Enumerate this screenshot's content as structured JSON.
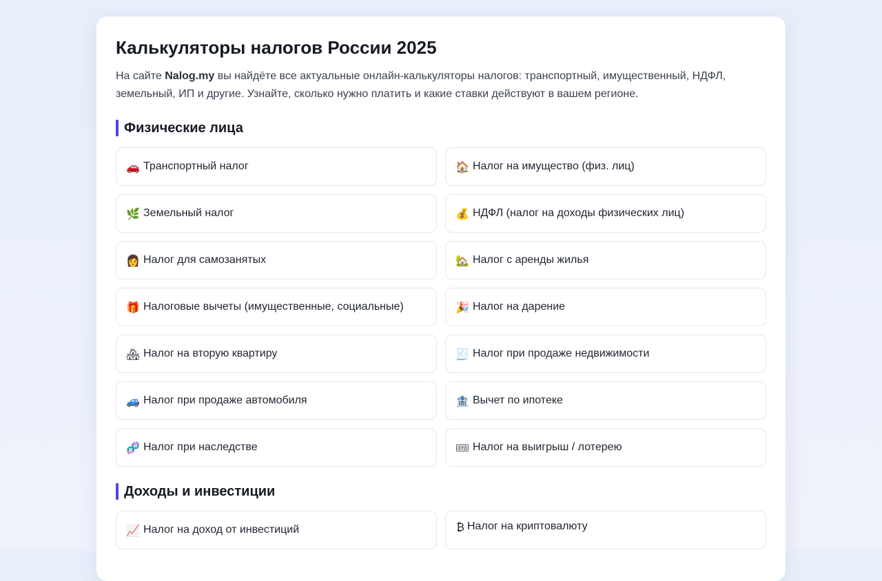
{
  "page": {
    "title": "Калькуляторы налогов России 2025",
    "intro_prefix": "На сайте ",
    "intro_brand": "Nalog.my",
    "intro_suffix": " вы найдёте все актуальные онлайн-калькуляторы налогов: транспортный, имущественный, НДФЛ, земельный, ИП и другие. Узнайте, сколько нужно платить и какие ставки действуют в вашем регионе."
  },
  "sections": [
    {
      "title": "Физические лица",
      "items": [
        {
          "icon": "🚗",
          "icon_name": "car-icon",
          "label": "Транспортный налог"
        },
        {
          "icon": "🏠",
          "icon_name": "house-icon",
          "label": "Налог на имущество (физ. лиц)"
        },
        {
          "icon": "🌿",
          "icon_name": "herb-icon",
          "label": "Земельный налог"
        },
        {
          "icon": "💰",
          "icon_name": "money-bag-icon",
          "label": "НДФЛ (налог на доходы физических лиц)"
        },
        {
          "icon": "👩",
          "icon_name": "worker-icon",
          "label": "Налог для самозанятых"
        },
        {
          "icon": "🏡",
          "icon_name": "house-garden-icon",
          "label": "Налог с аренды жилья"
        },
        {
          "icon": "🎁",
          "icon_name": "gift-icon",
          "label": "Налоговые вычеты (имущественные, социальные)"
        },
        {
          "icon": "🎉",
          "icon_name": "party-popper-icon",
          "label": "Налог на дарение"
        },
        {
          "icon": "🏘",
          "icon_name": "houses-icon",
          "label": "Налог на вторую квартиру"
        },
        {
          "icon": "🧾",
          "icon_name": "receipt-icon",
          "label": "Налог при продаже недвижимости"
        },
        {
          "icon": "🚙",
          "icon_name": "suv-icon",
          "label": "Налог при продаже автомобиля"
        },
        {
          "icon": "🏦",
          "icon_name": "bank-icon",
          "label": "Вычет по ипотеке"
        },
        {
          "icon": "🧬",
          "icon_name": "dna-icon",
          "label": "Налог при наследстве"
        },
        {
          "icon": "🎟",
          "icon_name": "ticket-icon",
          "label": "Налог на выигрыш / лотерею"
        }
      ]
    },
    {
      "title": "Доходы и инвестиции",
      "items": [
        {
          "icon": "📈",
          "icon_name": "chart-up-icon",
          "label": "Налог на доход от инвестиций"
        },
        {
          "icon": "₿",
          "icon_name": "bitcoin-icon",
          "label": "Налог на криптовалюту"
        }
      ]
    }
  ]
}
